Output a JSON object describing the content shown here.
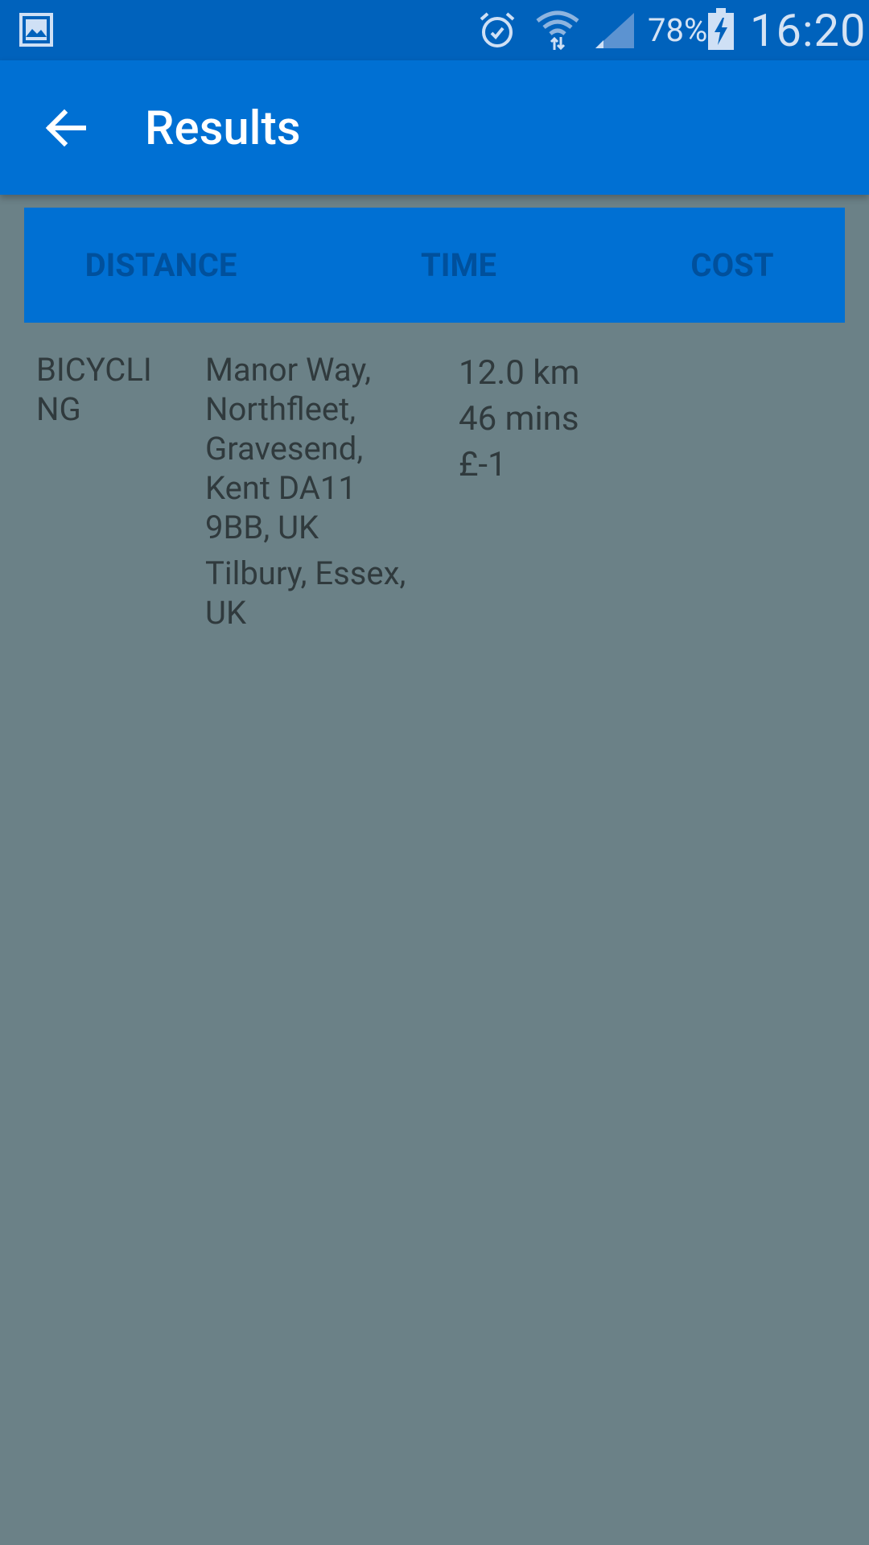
{
  "status_bar": {
    "battery_percent": "78%",
    "time": "16:20",
    "icons": [
      "gallery-icon",
      "alarm-icon",
      "wifi-icon",
      "signal-icon",
      "battery-charging-icon"
    ]
  },
  "app_bar": {
    "title": "Results",
    "back_icon": "arrow-back-icon"
  },
  "tabs": [
    {
      "label": "DISTANCE"
    },
    {
      "label": "TIME"
    },
    {
      "label": "COST"
    }
  ],
  "result": {
    "mode": "BICYCLING",
    "origin": "Manor Way, Northfleet, Gravesend, Kent DA11 9BB, UK",
    "destination": "Tilbury, Essex, UK",
    "distance": "12.0 km",
    "duration": "46 mins",
    "cost": "£-1"
  },
  "colors": {
    "status_bar": "#0062bc",
    "app_bar": "#0070d3",
    "tab_text": "#00509c",
    "background": "#6b8187",
    "body_text": "#303a3d"
  }
}
